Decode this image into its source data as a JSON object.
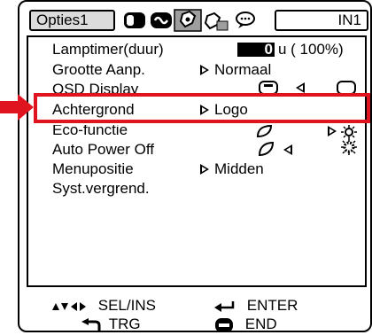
{
  "tabs": {
    "active_label": "Opties1",
    "input_label": "IN1",
    "icons": [
      "picture-icon",
      "sync-icon",
      "options1-icon",
      "options2-icon",
      "language-icon"
    ]
  },
  "menu": {
    "items": [
      {
        "label": "Lamptimer(duur)",
        "value": "0",
        "unit": "u ( 100%)"
      },
      {
        "label": "Grootte Aanp.",
        "value": "Normaal"
      },
      {
        "label": "OSD Display",
        "value": ""
      },
      {
        "label": "Achtergrond",
        "value": "Logo"
      },
      {
        "label": "Eco-functie",
        "value": ""
      },
      {
        "label": "Auto Power Off",
        "value": ""
      },
      {
        "label": "Menupositie",
        "value": "Midden"
      },
      {
        "label": "Syst.vergrend.",
        "value": ""
      }
    ],
    "selected_index": 3
  },
  "footer": {
    "sel": "SEL/INS",
    "enter": "ENTER",
    "trg": "TRG",
    "end": "END"
  },
  "colors": {
    "highlight": "#e0141e",
    "tab_active_bg": "#dcdcdc"
  }
}
